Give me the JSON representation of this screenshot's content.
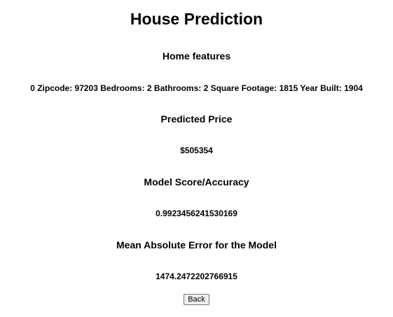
{
  "page": {
    "title": "House Prediction"
  },
  "features": {
    "heading": "Home features",
    "text": "0 Zipcode: 97203 Bedrooms: 2 Bathrooms: 2 Square Footage: 1815 Year Built: 1904"
  },
  "prediction": {
    "heading": "Predicted Price",
    "value": "$505354"
  },
  "score": {
    "heading": "Model Score/Accuracy",
    "value": "0.9923456241530169"
  },
  "mae": {
    "heading": "Mean Absolute Error for the Model",
    "value": "1474.2472202766915"
  },
  "actions": {
    "back_label": "Back"
  }
}
